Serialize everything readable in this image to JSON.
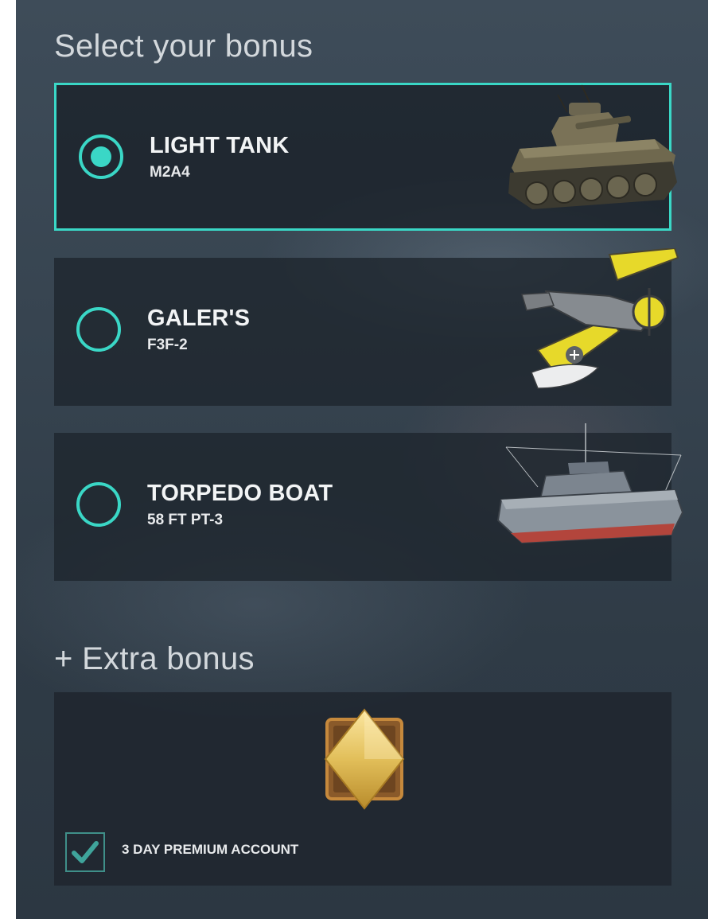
{
  "section_title": "Select your bonus",
  "bonus_options": [
    {
      "name": "LIGHT TANK",
      "model": "M2A4",
      "selected": true,
      "icon": "tank-icon"
    },
    {
      "name": "GALER'S",
      "model": "F3F-2",
      "selected": false,
      "icon": "biplane-icon"
    },
    {
      "name": "TORPEDO BOAT",
      "model": "58 FT PT-3",
      "selected": false,
      "icon": "torpedo-boat-icon"
    }
  ],
  "extra_title": "+ Extra bonus",
  "extra_bonus": {
    "label": "3 DAY PREMIUM ACCOUNT",
    "checked": true,
    "icon": "premium-diamond-icon"
  },
  "colors": {
    "accent": "#3ad7c6",
    "panel_background": "#36434f",
    "card_background": "#1e252d",
    "gold": "#e2bf5a"
  }
}
